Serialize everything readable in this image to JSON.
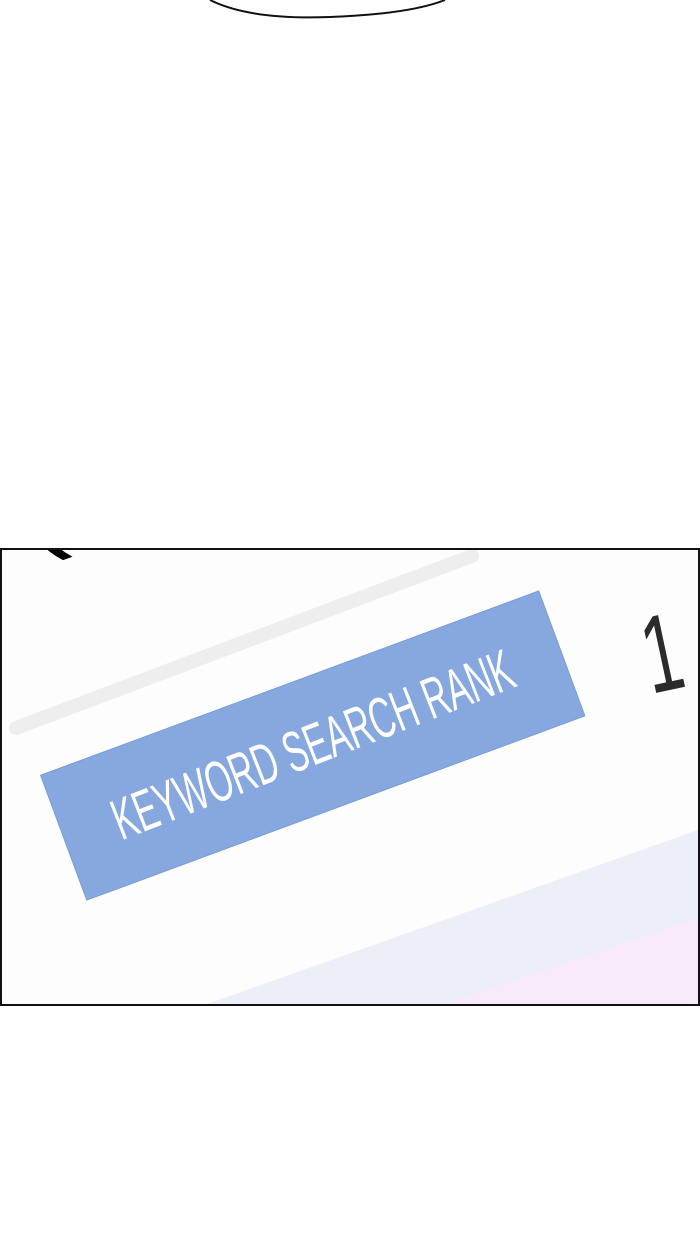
{
  "panel": {
    "corner_text": "(CO.)",
    "rank_number": "1",
    "keyword_label": "KEYWORD SEARCH RANK"
  },
  "colors": {
    "label_background": "#86a8df",
    "label_text": "#ffffff",
    "panel_border": "#111111",
    "number_color": "#2b2b2b",
    "bar_lavender": "#eceff8",
    "bar_pink": "#f8eafa"
  }
}
